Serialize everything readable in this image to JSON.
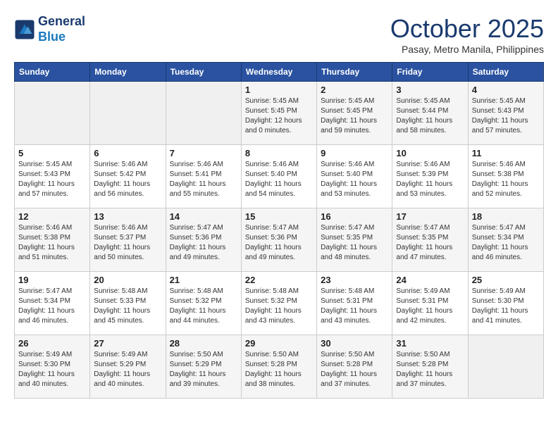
{
  "header": {
    "logo_line1": "General",
    "logo_line2": "Blue",
    "month_title": "October 2025",
    "subtitle": "Pasay, Metro Manila, Philippines"
  },
  "days_of_week": [
    "Sunday",
    "Monday",
    "Tuesday",
    "Wednesday",
    "Thursday",
    "Friday",
    "Saturday"
  ],
  "weeks": [
    [
      {
        "day": "",
        "info": ""
      },
      {
        "day": "",
        "info": ""
      },
      {
        "day": "",
        "info": ""
      },
      {
        "day": "1",
        "info": "Sunrise: 5:45 AM\nSunset: 5:45 PM\nDaylight: 12 hours\nand 0 minutes."
      },
      {
        "day": "2",
        "info": "Sunrise: 5:45 AM\nSunset: 5:45 PM\nDaylight: 11 hours\nand 59 minutes."
      },
      {
        "day": "3",
        "info": "Sunrise: 5:45 AM\nSunset: 5:44 PM\nDaylight: 11 hours\nand 58 minutes."
      },
      {
        "day": "4",
        "info": "Sunrise: 5:45 AM\nSunset: 5:43 PM\nDaylight: 11 hours\nand 57 minutes."
      }
    ],
    [
      {
        "day": "5",
        "info": "Sunrise: 5:45 AM\nSunset: 5:43 PM\nDaylight: 11 hours\nand 57 minutes."
      },
      {
        "day": "6",
        "info": "Sunrise: 5:46 AM\nSunset: 5:42 PM\nDaylight: 11 hours\nand 56 minutes."
      },
      {
        "day": "7",
        "info": "Sunrise: 5:46 AM\nSunset: 5:41 PM\nDaylight: 11 hours\nand 55 minutes."
      },
      {
        "day": "8",
        "info": "Sunrise: 5:46 AM\nSunset: 5:40 PM\nDaylight: 11 hours\nand 54 minutes."
      },
      {
        "day": "9",
        "info": "Sunrise: 5:46 AM\nSunset: 5:40 PM\nDaylight: 11 hours\nand 53 minutes."
      },
      {
        "day": "10",
        "info": "Sunrise: 5:46 AM\nSunset: 5:39 PM\nDaylight: 11 hours\nand 53 minutes."
      },
      {
        "day": "11",
        "info": "Sunrise: 5:46 AM\nSunset: 5:38 PM\nDaylight: 11 hours\nand 52 minutes."
      }
    ],
    [
      {
        "day": "12",
        "info": "Sunrise: 5:46 AM\nSunset: 5:38 PM\nDaylight: 11 hours\nand 51 minutes."
      },
      {
        "day": "13",
        "info": "Sunrise: 5:46 AM\nSunset: 5:37 PM\nDaylight: 11 hours\nand 50 minutes."
      },
      {
        "day": "14",
        "info": "Sunrise: 5:47 AM\nSunset: 5:36 PM\nDaylight: 11 hours\nand 49 minutes."
      },
      {
        "day": "15",
        "info": "Sunrise: 5:47 AM\nSunset: 5:36 PM\nDaylight: 11 hours\nand 49 minutes."
      },
      {
        "day": "16",
        "info": "Sunrise: 5:47 AM\nSunset: 5:35 PM\nDaylight: 11 hours\nand 48 minutes."
      },
      {
        "day": "17",
        "info": "Sunrise: 5:47 AM\nSunset: 5:35 PM\nDaylight: 11 hours\nand 47 minutes."
      },
      {
        "day": "18",
        "info": "Sunrise: 5:47 AM\nSunset: 5:34 PM\nDaylight: 11 hours\nand 46 minutes."
      }
    ],
    [
      {
        "day": "19",
        "info": "Sunrise: 5:47 AM\nSunset: 5:34 PM\nDaylight: 11 hours\nand 46 minutes."
      },
      {
        "day": "20",
        "info": "Sunrise: 5:48 AM\nSunset: 5:33 PM\nDaylight: 11 hours\nand 45 minutes."
      },
      {
        "day": "21",
        "info": "Sunrise: 5:48 AM\nSunset: 5:32 PM\nDaylight: 11 hours\nand 44 minutes."
      },
      {
        "day": "22",
        "info": "Sunrise: 5:48 AM\nSunset: 5:32 PM\nDaylight: 11 hours\nand 43 minutes."
      },
      {
        "day": "23",
        "info": "Sunrise: 5:48 AM\nSunset: 5:31 PM\nDaylight: 11 hours\nand 43 minutes."
      },
      {
        "day": "24",
        "info": "Sunrise: 5:49 AM\nSunset: 5:31 PM\nDaylight: 11 hours\nand 42 minutes."
      },
      {
        "day": "25",
        "info": "Sunrise: 5:49 AM\nSunset: 5:30 PM\nDaylight: 11 hours\nand 41 minutes."
      }
    ],
    [
      {
        "day": "26",
        "info": "Sunrise: 5:49 AM\nSunset: 5:30 PM\nDaylight: 11 hours\nand 40 minutes."
      },
      {
        "day": "27",
        "info": "Sunrise: 5:49 AM\nSunset: 5:29 PM\nDaylight: 11 hours\nand 40 minutes."
      },
      {
        "day": "28",
        "info": "Sunrise: 5:50 AM\nSunset: 5:29 PM\nDaylight: 11 hours\nand 39 minutes."
      },
      {
        "day": "29",
        "info": "Sunrise: 5:50 AM\nSunset: 5:28 PM\nDaylight: 11 hours\nand 38 minutes."
      },
      {
        "day": "30",
        "info": "Sunrise: 5:50 AM\nSunset: 5:28 PM\nDaylight: 11 hours\nand 37 minutes."
      },
      {
        "day": "31",
        "info": "Sunrise: 5:50 AM\nSunset: 5:28 PM\nDaylight: 11 hours\nand 37 minutes."
      },
      {
        "day": "",
        "info": ""
      }
    ]
  ]
}
